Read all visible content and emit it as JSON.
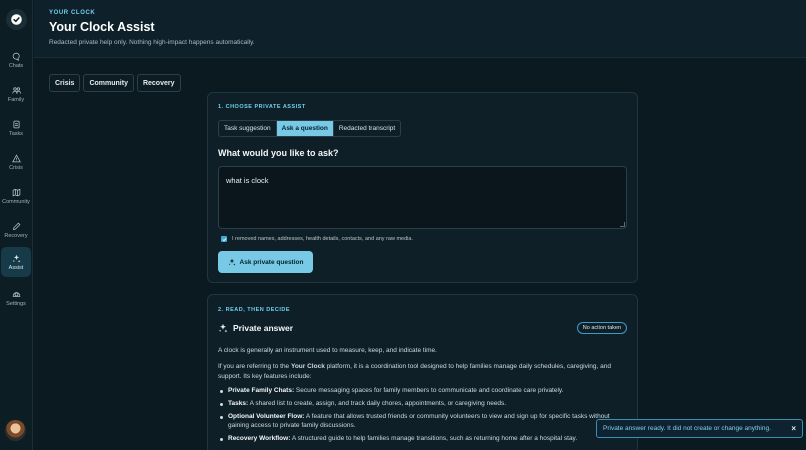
{
  "sidebar": {
    "items": [
      {
        "label": "Chats",
        "icon": "chat-icon"
      },
      {
        "label": "Family",
        "icon": "family-icon"
      },
      {
        "label": "Tasks",
        "icon": "tasks-icon"
      },
      {
        "label": "Crisis",
        "icon": "warning-icon"
      },
      {
        "label": "Community",
        "icon": "map-icon"
      },
      {
        "label": "Recovery",
        "icon": "pencil-icon"
      },
      {
        "label": "Assist",
        "icon": "sparkle-icon",
        "active": true
      },
      {
        "label": "Settings",
        "icon": "settings-icon"
      }
    ]
  },
  "header": {
    "eyebrow": "YOUR CLOCK",
    "title": "Your Clock Assist",
    "subtitle": "Redacted private help only. Nothing high-impact happens automatically."
  },
  "top_tabs": [
    "Crisis",
    "Community",
    "Recovery"
  ],
  "card1": {
    "eyebrow": "1. CHOOSE PRIVATE ASSIST",
    "modes": [
      "Task suggestion",
      "Ask a question",
      "Redacted transcript"
    ],
    "active_mode": "Ask a question",
    "question_label": "What would you like to ask?",
    "question_value": "what is clock",
    "checkbox_label": "I removed names, addresses, health details, contacts, and any raw media.",
    "checkbox_checked": true,
    "ask_button": "Ask private question"
  },
  "card2": {
    "eyebrow": "2. READ, THEN DECIDE",
    "answer_title": "Private answer",
    "badge": "No action taken",
    "p1": "A clock is generally an instrument used to measure, keep, and indicate time.",
    "p2_pre": "If you are referring to the ",
    "p2_bold": "Your Clock",
    "p2_post": " platform, it is a coordination tool designed to help families manage daily schedules, caregiving, and support. Its key features include:",
    "features": [
      {
        "title": "Private Family Chats:",
        "text": " Secure messaging spaces for family members to communicate and coordinate care privately."
      },
      {
        "title": "Tasks:",
        "text": " A shared list to create, assign, and track daily chores, appointments, or caregiving needs."
      },
      {
        "title": "Optional Volunteer Flow:",
        "text": " A feature that allows trusted friends or community volunteers to view and sign up for specific tasks without gaining access to private family discussions."
      },
      {
        "title": "Recovery Workflow:",
        "text": " A structured guide to help families manage transitions, such as returning home after a hospital stay."
      }
    ]
  },
  "toast": {
    "message": "Private answer ready. It did not create or change anything.",
    "close": "×"
  },
  "colors": {
    "accent": "#77c9e5",
    "background": "#0b1a21",
    "eyebrow": "#6fd1ef"
  }
}
